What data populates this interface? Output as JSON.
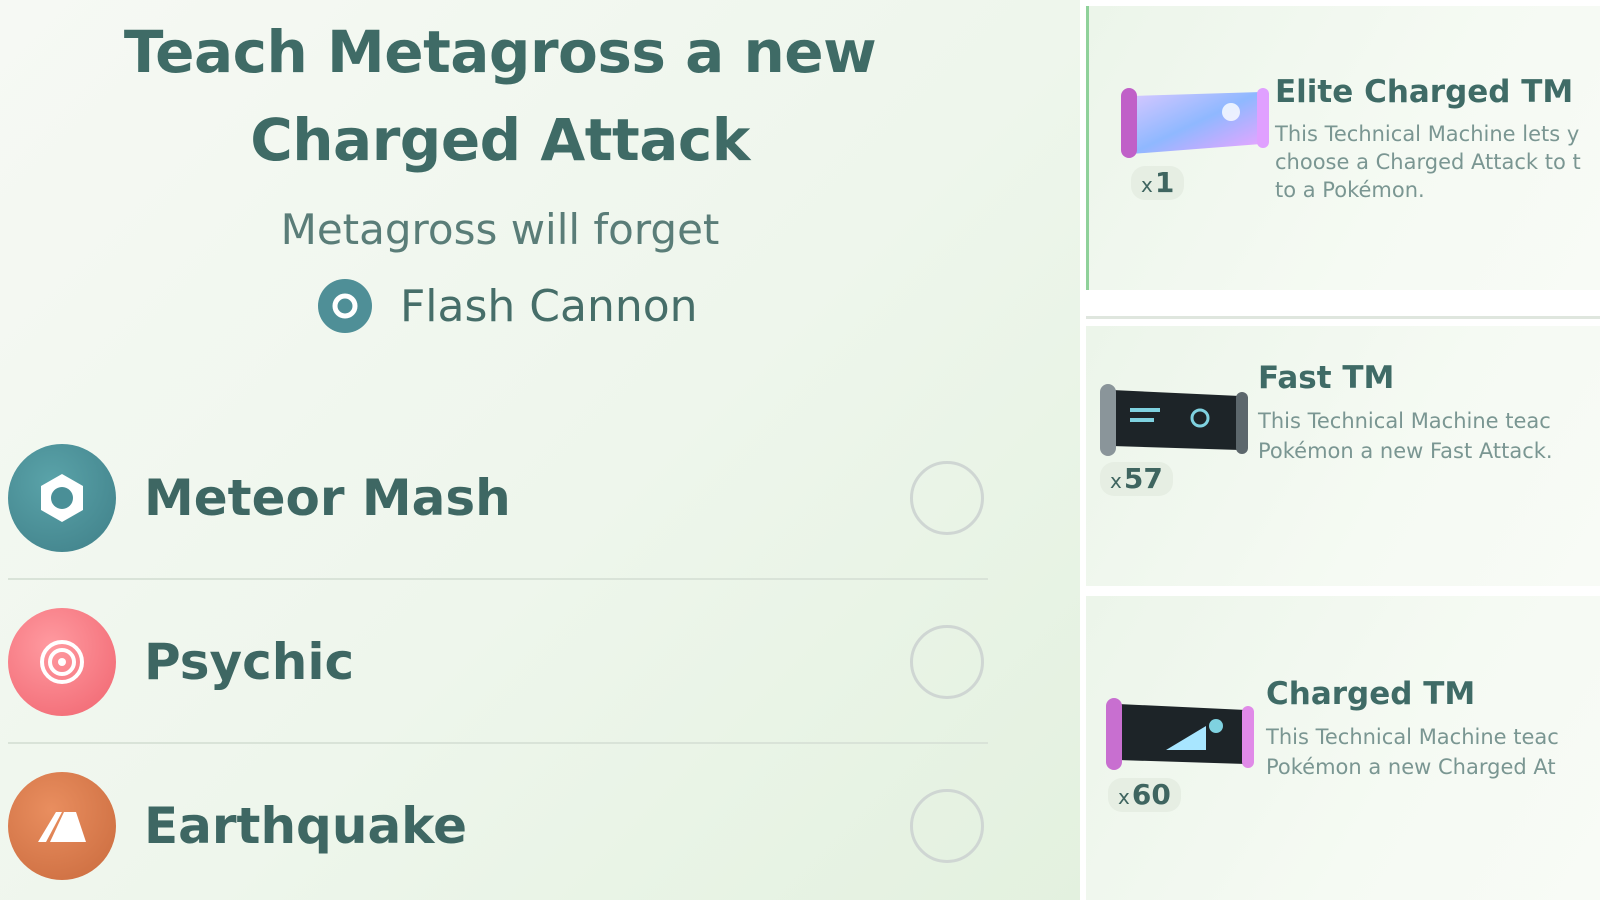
{
  "teach": {
    "title": "Teach Metagross a new Charged Attack",
    "forget_label": "Metagross will forget",
    "forget_move": "Flash Cannon",
    "moves": [
      {
        "name": "Meteor Mash",
        "type_icon": "steel-type-icon",
        "color": "#4a8f97"
      },
      {
        "name": "Psychic",
        "type_icon": "psychic-type-icon",
        "color": "#f3747d"
      },
      {
        "name": "Earthquake",
        "type_icon": "ground-type-icon",
        "color": "#d3774a"
      }
    ]
  },
  "items": [
    {
      "title": "Elite Charged TM",
      "count_prefix": "x",
      "count": "1",
      "desc_lines": [
        "This Technical Machine lets y",
        "choose a Charged Attack to t",
        "to a Pokémon."
      ]
    },
    {
      "title": "Fast TM",
      "count_prefix": "x",
      "count": "57",
      "desc_lines": [
        "This Technical Machine teac",
        "Pokémon a new Fast Attack."
      ]
    },
    {
      "title": "Charged TM",
      "count_prefix": "x",
      "count": "60",
      "desc_lines": [
        "This Technical Machine teac",
        "Pokémon a new Charged At"
      ]
    }
  ]
}
